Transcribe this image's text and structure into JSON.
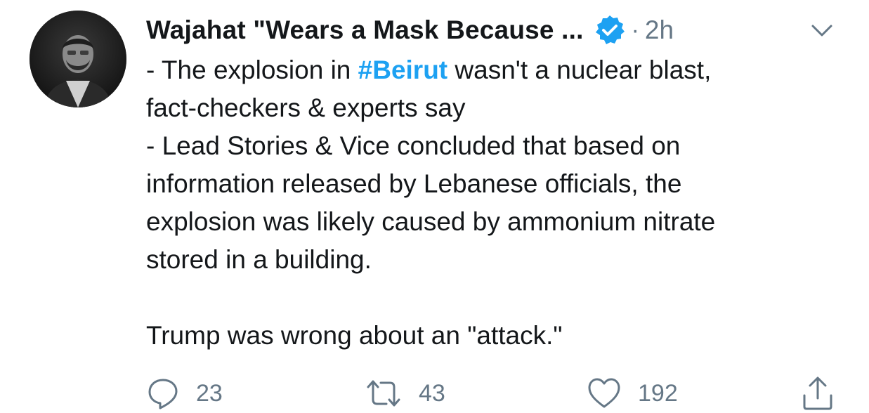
{
  "tweet": {
    "author": {
      "display_name": "Wajahat \"Wears a Mask Because ...",
      "verified": true,
      "avatar": "profile-photo"
    },
    "separator": "·",
    "time": "2h",
    "menu_icon": "chevron-down-icon",
    "text": {
      "line1_prefix": "- The explosion in ",
      "hashtag": "#Beirut",
      "line1_suffix": " wasn't a nuclear blast,",
      "line2": "fact-checkers & experts say",
      "line3": "- Lead Stories & Vice concluded that based on",
      "line4": "information released by Lebanese officials, the",
      "line5": "explosion was likely caused by ammonium nitrate",
      "line6": "stored in a building.",
      "line8": "Trump was wrong about an \"attack.\""
    },
    "actions": {
      "reply": {
        "icon": "reply-icon",
        "count": "23"
      },
      "retweet": {
        "icon": "retweet-icon",
        "count": "43"
      },
      "like": {
        "icon": "heart-icon",
        "count": "192"
      },
      "share": {
        "icon": "share-icon"
      }
    }
  },
  "colors": {
    "text": "#14171a",
    "secondary": "#657786",
    "accent": "#1da1f2"
  }
}
